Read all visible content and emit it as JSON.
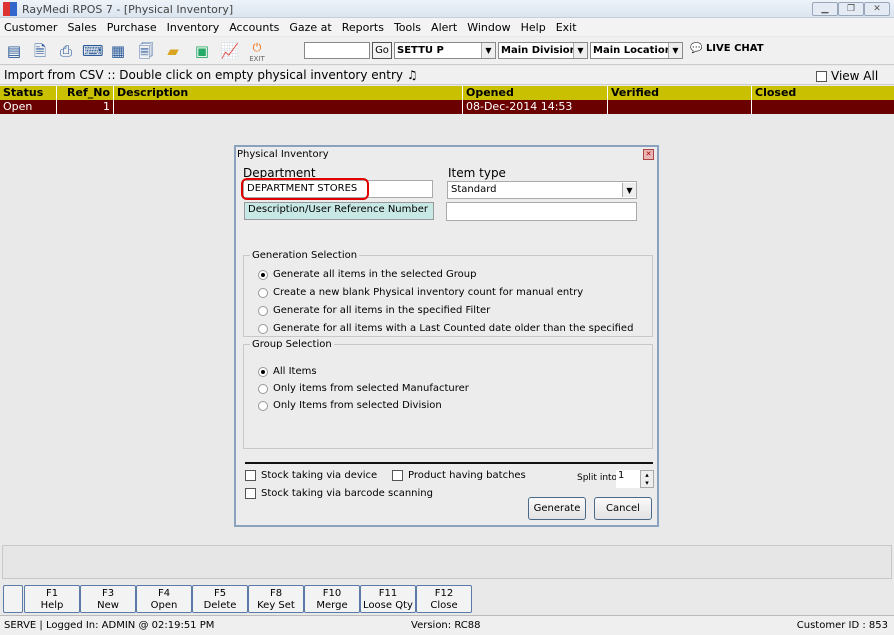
{
  "window": {
    "title": "RayMedi RPOS 7 - [Physical Inventory]"
  },
  "menu": [
    "Customer",
    "Sales",
    "Purchase",
    "Inventory",
    "Accounts",
    "Gaze at",
    "Reports",
    "Tools",
    "Alert",
    "Window",
    "Help",
    "Exit"
  ],
  "toolbar": {
    "go_label": "Go",
    "search_value": "",
    "user": "SETTU P",
    "division": "Main Division",
    "location": "Main Location",
    "live_chat": "LIVE CHAT",
    "exit_label": "EXIT"
  },
  "info": {
    "text": "Import from CSV :: Double click on empty physical inventory entry",
    "view_all": "View All"
  },
  "table": {
    "columns": [
      "Status",
      "Ref_No",
      "Description",
      "Opened",
      "Verified",
      "Closed"
    ],
    "rows": [
      {
        "status": "Open",
        "ref_no": "1",
        "description": "",
        "opened": "08-Dec-2014 14:53",
        "verified": "",
        "closed": ""
      }
    ]
  },
  "dialog": {
    "title": "Physical Inventory",
    "department_label": "Department",
    "department_value": "DEPARTMENT STORES",
    "item_type_label": "Item type",
    "item_type_value": "Standard",
    "desc_label": "Description/User Reference Number",
    "desc_value": "",
    "generation": {
      "title": "Generation Selection",
      "options": [
        "Generate all items in the selected Group",
        "Create a new blank Physical inventory count for manual entry",
        "Generate for all items in the specified Filter",
        "Generate for all items with a Last Counted date older than the specified"
      ],
      "selected": 0
    },
    "group": {
      "title": "Group Selection",
      "options": [
        "All Items",
        "Only items from selected Manufacturer",
        "Only Items from selected Division"
      ],
      "selected": 0
    },
    "stock_device": "Stock taking via device",
    "product_batches": "Product having batches",
    "stock_barcode": "Stock taking via barcode scanning",
    "split_label": "Split into",
    "split_value": "1",
    "generate": "Generate",
    "cancel": "Cancel"
  },
  "fkeys": [
    {
      "k": "F1",
      "l": "Help"
    },
    {
      "k": "F3",
      "l": "New"
    },
    {
      "k": "F4",
      "l": "Open"
    },
    {
      "k": "F5",
      "l": "Delete"
    },
    {
      "k": "F8",
      "l": "Key Set"
    },
    {
      "k": "F10",
      "l": "Merge"
    },
    {
      "k": "F11",
      "l": "Loose Qty"
    },
    {
      "k": "F12",
      "l": "Close"
    }
  ],
  "status": {
    "left": "SERVE |  Logged In: ADMIN  @ 02:19:51 PM",
    "version": "Version: RC88",
    "customer": "Customer ID : 853"
  },
  "colors": {
    "header": "#c8c000",
    "row": "#6a0000",
    "highlight": "#e00000"
  }
}
